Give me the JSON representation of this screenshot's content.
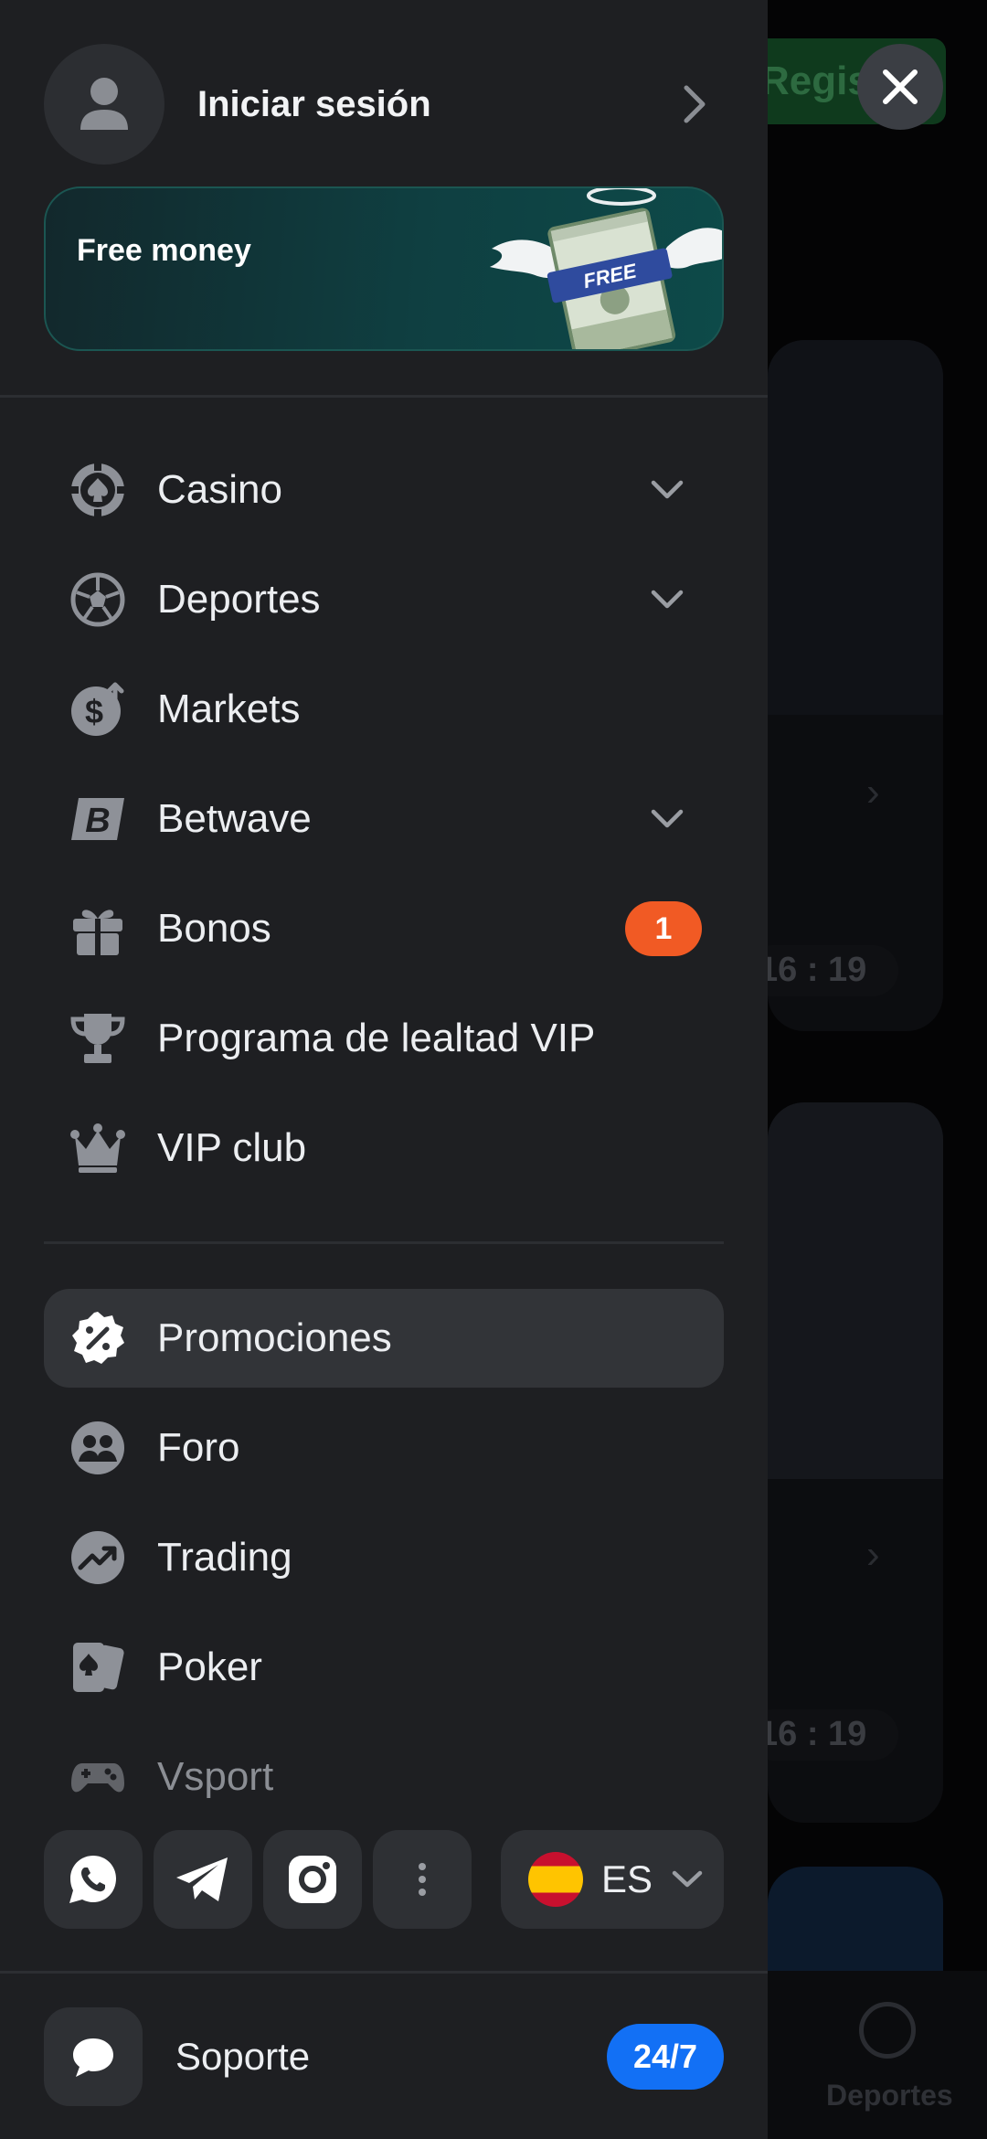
{
  "background": {
    "register_label": "Registr",
    "timer_1": "16 : 19",
    "timer_2": "16 : 19",
    "bottom_tab_label": "Deportes"
  },
  "header": {
    "login_label": "Iniciar sesión"
  },
  "banner": {
    "text": "Free money",
    "bill_label": "FREE"
  },
  "menu_primary": [
    {
      "label": "Casino",
      "icon": "casino-chip-icon",
      "has_dropdown": true
    },
    {
      "label": "Deportes",
      "icon": "soccer-ball-icon",
      "has_dropdown": true
    },
    {
      "label": "Markets",
      "icon": "dollar-arrow-icon",
      "has_dropdown": false
    },
    {
      "label": "Betwave",
      "icon": "betwave-b-icon",
      "has_dropdown": true
    },
    {
      "label": "Bonos",
      "icon": "gift-icon",
      "badge": "1"
    },
    {
      "label": "Programa de lealtad VIP",
      "icon": "trophy-icon"
    },
    {
      "label": "VIP club",
      "icon": "crown-icon"
    }
  ],
  "menu_secondary": [
    {
      "label": "Promociones",
      "icon": "percent-badge-icon",
      "active": true
    },
    {
      "label": "Foro",
      "icon": "forum-people-icon"
    },
    {
      "label": "Trading",
      "icon": "trending-up-icon"
    },
    {
      "label": "Poker",
      "icon": "poker-cards-icon"
    },
    {
      "label": "Vsport",
      "icon": "gamepad-icon"
    }
  ],
  "social": [
    "whatsapp-icon",
    "telegram-icon",
    "instagram-icon",
    "more-vertical-icon"
  ],
  "language": {
    "code": "ES",
    "flag": "spain-flag"
  },
  "support": {
    "label": "Soporte",
    "badge": "24/7"
  },
  "colors": {
    "drawer_bg": "#1e1f22",
    "active_item_bg": "#323438",
    "badge_orange": "#f15a24",
    "support_blue": "#1270f5",
    "banner_teal": "#0f3f41"
  }
}
